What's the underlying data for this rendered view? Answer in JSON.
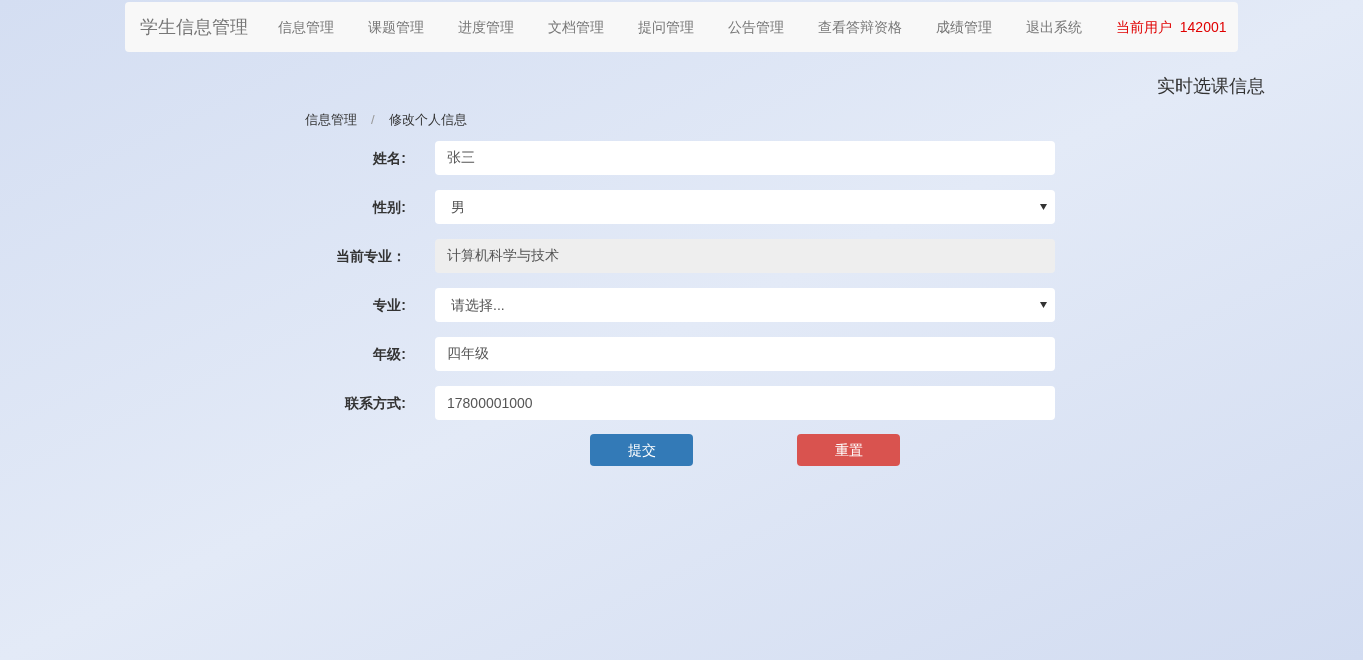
{
  "navbar": {
    "brand": "学生信息管理",
    "items": [
      "信息管理",
      "课题管理",
      "进度管理",
      "文档管理",
      "提问管理",
      "公告管理",
      "查看答辩资格",
      "成绩管理",
      "退出系统"
    ],
    "user_label": "当前用户",
    "user_id": "142001"
  },
  "side_title": "实时选课信息",
  "breadcrumb": [
    "信息管理",
    "修改个人信息"
  ],
  "breadcrumb_separator": "/",
  "form": [
    {
      "label": "姓名:",
      "kind": "text",
      "value": "张三"
    },
    {
      "label": "性别:",
      "kind": "select",
      "value": "男"
    },
    {
      "label": "当前专业：",
      "kind": "disabled",
      "value": "计算机科学与技术"
    },
    {
      "label": "专业:",
      "kind": "select",
      "value": "请选择..."
    },
    {
      "label": "年级:",
      "kind": "text",
      "value": "四年级"
    },
    {
      "label": "联系方式:",
      "kind": "text",
      "value": "17800001000"
    }
  ],
  "buttons": [
    {
      "label": "提交",
      "kind": "primary"
    },
    {
      "label": "重置",
      "kind": "danger"
    }
  ]
}
